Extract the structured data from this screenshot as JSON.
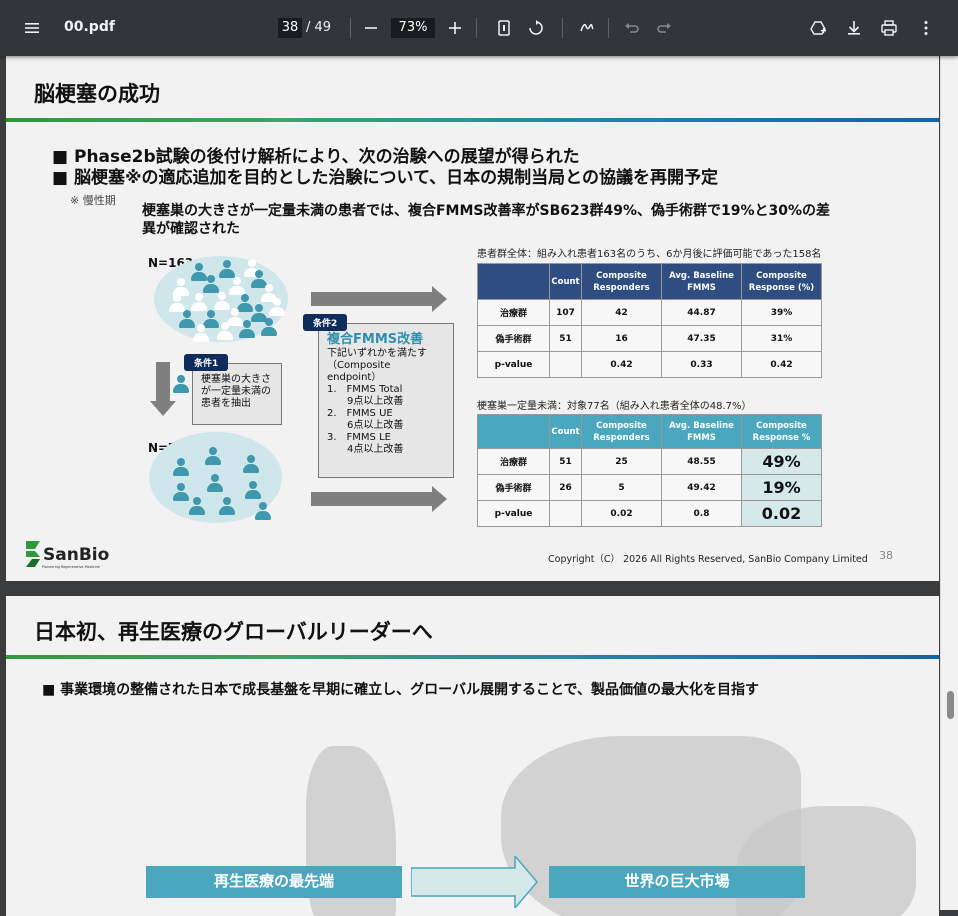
{
  "toolbar": {
    "filename": "00.pdf",
    "current_page": "38",
    "total_pages": "/ 49",
    "zoom": "73%",
    "icons": [
      "menu-icon",
      "zoom-out-icon",
      "zoom-in-icon",
      "fit-page-icon",
      "rotate-icon",
      "annotate-icon",
      "undo-icon",
      "redo-icon",
      "drive-icon",
      "download-icon",
      "print-icon",
      "more-icon"
    ]
  },
  "slide1": {
    "title": "脳梗塞の成功",
    "bullets": [
      "■ Phase2b試験の後付け解析により、次の治験への展望が得られた",
      "■ 脳梗塞※の適応追加を目的とした治験について、日本の規制当局との協議を再開予定"
    ],
    "note": "※ 慢性期",
    "subtitle": "梗塞巣の大きさが一定量未満の患者では、複合FMMS改善率がSB623群49%、偽手術群で19%と30%の差異が確認された",
    "n163": "N=163",
    "n77": "N=77",
    "cond1_tag": "条件1",
    "cond1_text": [
      "梗塞巣の大きさ",
      "が一定量未満の",
      "患者を抽出"
    ],
    "cond2_tag": "条件2",
    "cond2_head": "複合FMMS改善",
    "cond2_lines": [
      "下記いずれかを満たす",
      "（Composite",
      "endpoint）",
      "1.　FMMS Total",
      "　　9点以上改善",
      "2.　FMMS UE",
      "　　6点以上改善",
      "3.　FMMS LE",
      "　　4点以上改善"
    ],
    "table1_caption": "患者群全体：組み入れ患者163名のうち、6か月後に評価可能であった158名",
    "table2_caption": "梗塞巣一定量未満：対象77名（組み入れ患者全体の48.7%）",
    "table_headers": [
      "",
      "Count",
      "Composite Responders",
      "Avg. Baseline FMMS",
      "Composite Response (%)"
    ],
    "table2_headers": [
      "",
      "Count",
      "Composite Responders",
      "Avg. Baseline FMMS",
      "Composite Response %"
    ],
    "table1_rows": [
      [
        "治療群",
        "107",
        "42",
        "44.87",
        "39%"
      ],
      [
        "偽手術群",
        "51",
        "16",
        "47.35",
        "31%"
      ],
      [
        "p-value",
        "",
        "0.42",
        "0.33",
        "0.42"
      ]
    ],
    "table2_rows": [
      [
        "治療群",
        "51",
        "25",
        "48.55",
        "49%"
      ],
      [
        "偽手術群",
        "26",
        "5",
        "49.42",
        "19%"
      ],
      [
        "p-value",
        "",
        "0.02",
        "0.8",
        "0.02"
      ]
    ],
    "logo_text": "SanBio",
    "logo_tagline": "Pioneering Regenerative Medicine",
    "copyright": "Copyright（C） 2026 All Rights Reserved, SanBio Company Limited",
    "page_number": "38",
    "colors": {
      "header_blue": "#2f4d80",
      "accent_teal": "#4aa7be",
      "highlight": "#d5e8ea"
    }
  },
  "slide2": {
    "title": "日本初、再生医療のグローバルリーダーへ",
    "bullet": "■ 事業環境の整備された日本で成長基盤を早期に確立し、グローバル展開することで、製品価値の最大化を目指す",
    "box_left": "再生医療の最先端",
    "box_right": "世界の巨大市場"
  }
}
